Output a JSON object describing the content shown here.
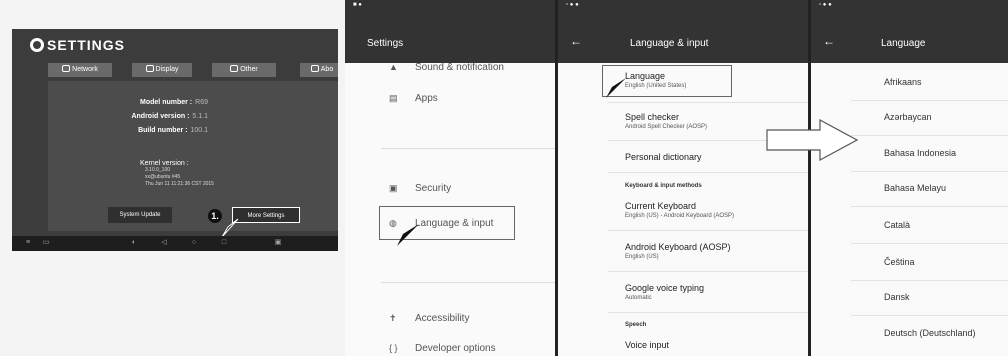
{
  "box_settings": {
    "title": "SETTINGS",
    "tabs": [
      {
        "label": "Network",
        "icon": "network-icon"
      },
      {
        "label": "Display",
        "icon": "display-icon"
      },
      {
        "label": "Other",
        "icon": "other-icon"
      },
      {
        "label": "Abo",
        "icon": "about-icon"
      }
    ],
    "model_label": "Model number :",
    "model_value": "R69",
    "android_label": "Android version :",
    "android_value": "5.1.1",
    "build_label": "Build number :",
    "build_value": "100.1",
    "kernel_label": "Kernel version :",
    "kernel_lines": [
      "3.10.0_100",
      "xx@ubuntu #45",
      "Thu Jun 11 11:21:36 CST 2015"
    ],
    "system_update": "System Update",
    "more_settings": "More Settings",
    "step_badge": "1."
  },
  "settings_panel": {
    "status": "■ ●",
    "title": "Settings",
    "items": [
      {
        "label": "Sound & notification",
        "icon": "bell-icon"
      },
      {
        "label": "Apps",
        "icon": "apps-icon"
      },
      {
        "label": "Security",
        "icon": "lock-icon"
      },
      {
        "label": "Language & input",
        "icon": "globe-icon"
      },
      {
        "label": "Accessibility",
        "icon": "accessibility-icon"
      },
      {
        "label": "Developer options",
        "icon": "code-icon"
      }
    ]
  },
  "language_input_panel": {
    "status": "▫ ● ●",
    "title": "Language & input",
    "language_title": "Language",
    "language_sub": "English (United States)",
    "spell_title": "Spell checker",
    "spell_sub": "Android Spell Checker (AOSP)",
    "personal_dict": "Personal dictionary",
    "keyboard_header": "Keyboard & input methods",
    "current_kb_title": "Current Keyboard",
    "current_kb_sub": "English (US) - Android Keyboard (AOSP)",
    "android_kb_title": "Android Keyboard (AOSP)",
    "android_kb_sub": "English (US)",
    "google_voice_title": "Google voice typing",
    "google_voice_sub": "Automatic",
    "speech_header": "Speech",
    "voice_input": "Voice input"
  },
  "language_panel": {
    "status": "▫ ● ●",
    "title": "Language",
    "languages": [
      "Afrikaans",
      "Azərbaycan",
      "Bahasa Indonesia",
      "Bahasa Melayu",
      "Català",
      "Čeština",
      "Dansk",
      "Deutsch (Deutschland)"
    ]
  },
  "colors": {
    "toolbar": "#333333",
    "box_bg": "#3c3c3c",
    "accent": "#ffffff"
  }
}
